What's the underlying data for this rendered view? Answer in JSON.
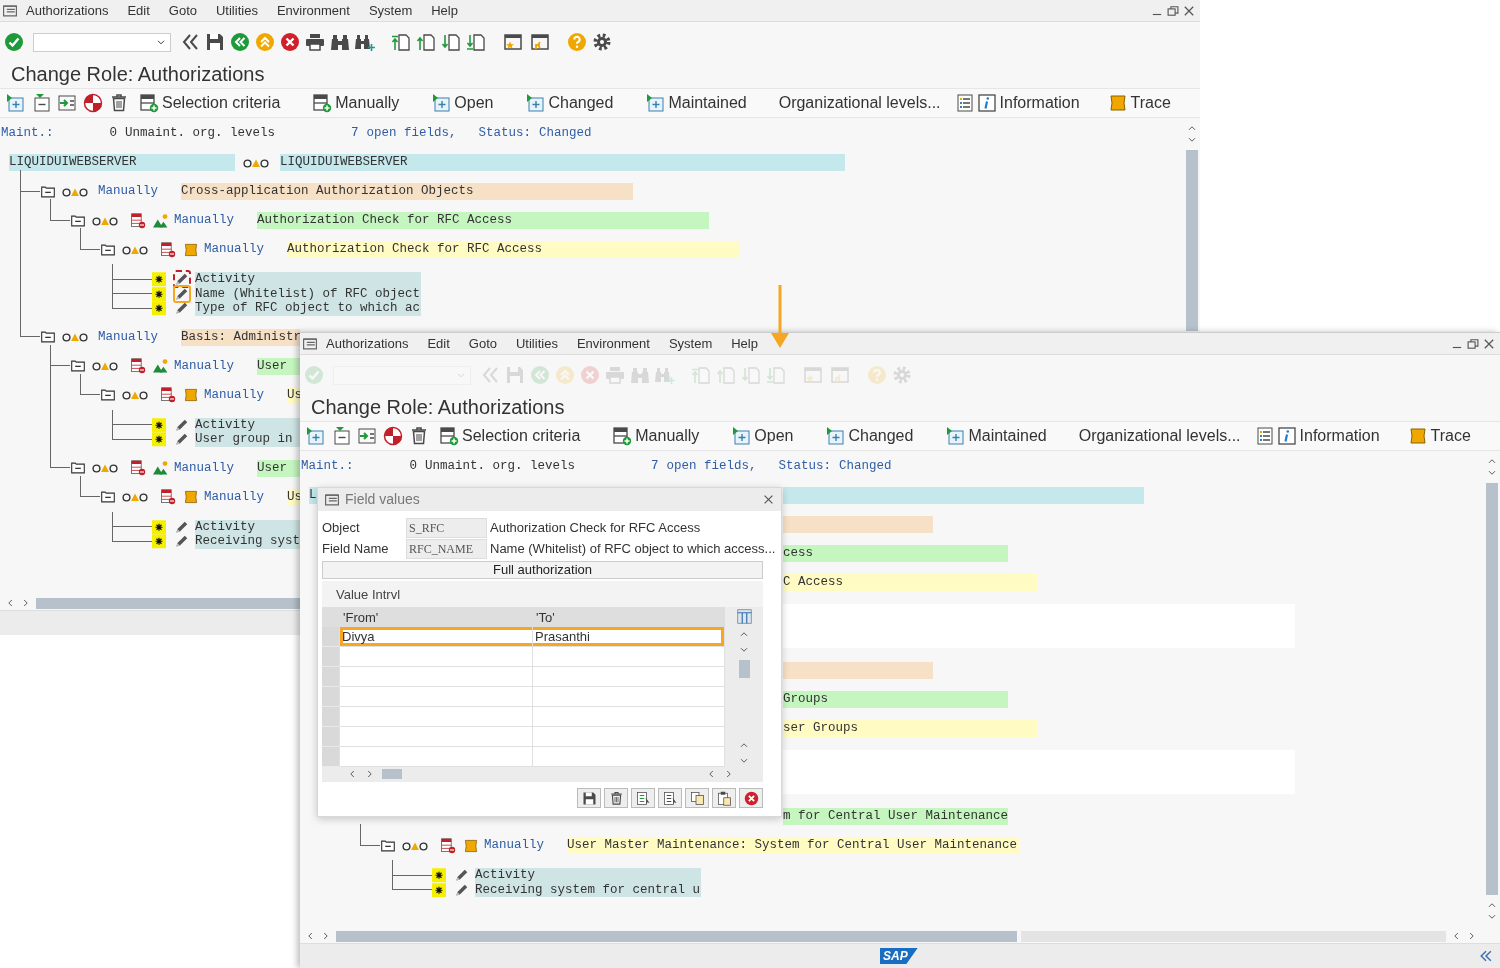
{
  "windows": [
    {
      "menu": [
        "Authorizations",
        "Edit",
        "Goto",
        "Utilities",
        "Environment",
        "System",
        "Help"
      ],
      "toolbar": {
        "disabled": false
      },
      "title": "Change Role: Authorizations",
      "app_toolbar": [
        {
          "label": "Selection criteria"
        },
        {
          "label": "Manually"
        },
        {
          "label": "Open"
        },
        {
          "label": "Changed"
        },
        {
          "label": "Maintained"
        },
        {
          "label": "Organizational levels..."
        },
        {
          "label": "Information"
        },
        {
          "label": "Trace"
        }
      ],
      "status_line": [
        {
          "text": "Maint.:",
          "kind": "label"
        },
        {
          "text": "0",
          "kind": "value"
        },
        {
          "text": "Unmaint. org. levels",
          "kind": "value"
        },
        {
          "text": "7",
          "kind": "label"
        },
        {
          "text": "open fields,",
          "kind": "label"
        },
        {
          "text": "Status:",
          "kind": "label"
        },
        {
          "text": "Changed",
          "kind": "label"
        }
      ],
      "tree": {
        "kind": "root",
        "text": "LIQUIDUIWEBSERVER",
        "text_2": "LIQUIDUIWEBSERVER",
        "children": [
          {
            "kind": "class",
            "status": "Manually",
            "text": "Cross-application Authorization Objects",
            "children": [
              {
                "kind": "object",
                "status": "Manually",
                "text": "Authorization Check for RFC Access",
                "children": [
                  {
                    "kind": "authorization",
                    "status": "Manually",
                    "text": "Authorization Check for RFC Access",
                    "fields": [
                      {
                        "text": "Activity",
                        "focused": true,
                        "highlighted": false
                      },
                      {
                        "text": "Name (Whitelist) of RFC object",
                        "focused": false,
                        "highlighted": true
                      },
                      {
                        "text": "Type of RFC object to which ac",
                        "focused": false,
                        "highlighted": false
                      }
                    ]
                  }
                ]
              }
            ]
          },
          {
            "kind": "class",
            "status": "Manually",
            "text": "Basis: Administr",
            "children": [
              {
                "kind": "object",
                "status": "Manually",
                "text": "User",
                "children": [
                  {
                    "kind": "authorization",
                    "status": "Manually",
                    "text": "Us",
                    "fields": [
                      {
                        "text": "Activity",
                        "focused": false,
                        "highlighted": false
                      },
                      {
                        "text": "User group in",
                        "focused": false,
                        "highlighted": false
                      }
                    ]
                  }
                ]
              },
              {
                "kind": "object",
                "status": "Manually",
                "text": "User",
                "children": [
                  {
                    "kind": "authorization",
                    "status": "Manually",
                    "text": "Us",
                    "fields": [
                      {
                        "text": "Activity",
                        "focused": false,
                        "highlighted": false
                      },
                      {
                        "text": "Receiving syst",
                        "focused": false,
                        "highlighted": false
                      }
                    ]
                  }
                ]
              }
            ]
          }
        ]
      }
    },
    {
      "menu": [
        "Authorizations",
        "Edit",
        "Goto",
        "Utilities",
        "Environment",
        "System",
        "Help"
      ],
      "toolbar": {
        "disabled": true
      },
      "title": "Change Role: Authorizations",
      "app_toolbar": [
        {
          "label": "Selection criteria"
        },
        {
          "label": "Manually"
        },
        {
          "label": "Open"
        },
        {
          "label": "Changed"
        },
        {
          "label": "Maintained"
        },
        {
          "label": "Organizational levels..."
        },
        {
          "label": "Information"
        },
        {
          "label": "Trace"
        }
      ],
      "status_line": [
        {
          "text": "Maint.:",
          "kind": "label"
        },
        {
          "text": "0",
          "kind": "value"
        },
        {
          "text": "Unmaint. org. levels",
          "kind": "value"
        },
        {
          "text": "7",
          "kind": "label"
        },
        {
          "text": "open fields,",
          "kind": "label"
        },
        {
          "text": "Status:",
          "kind": "label"
        },
        {
          "text": "Changed",
          "kind": "label"
        }
      ],
      "tree_rows": [
        {
          "kind": "root",
          "text": "L"
        },
        {
          "kind": "class"
        },
        {
          "kind": "object",
          "text": "cess"
        },
        {
          "kind": "authorization",
          "text": "C Access"
        },
        {
          "kind": "field-group"
        },
        {
          "kind": "class"
        },
        {
          "kind": "object",
          "text": "Groups"
        },
        {
          "kind": "authorization",
          "text": "ser Groups"
        },
        {
          "kind": "field-group"
        },
        {
          "kind": "object",
          "text": "m for Central User Maintenance"
        }
      ],
      "tree_tail": {
        "kind": "authorization",
        "status": "Manually",
        "text": "User Master Maintenance: System for Central User Maintenance",
        "fields": [
          {
            "text": "Activity",
            "focused": false,
            "highlighted": false
          },
          {
            "text": "Receiving system for central u",
            "focused": false,
            "highlighted": false
          }
        ]
      },
      "footer": {
        "logo": "SAP"
      },
      "dialog": {
        "title": "Field values",
        "rows": [
          {
            "label": "Object",
            "value": "S_RFC",
            "description": "Authorization Check for RFC Access"
          },
          {
            "label": "Field Name",
            "value": "RFC_NAME",
            "description": "Name (Whitelist) of RFC object to which access..."
          }
        ],
        "button": "Full authorization",
        "section": "Value Intrvl",
        "columns": [
          "'From'",
          "'To'"
        ],
        "values": [
          {
            "from": "Divya",
            "to": "Prasanthi",
            "highlighted": true
          }
        ]
      }
    }
  ]
}
